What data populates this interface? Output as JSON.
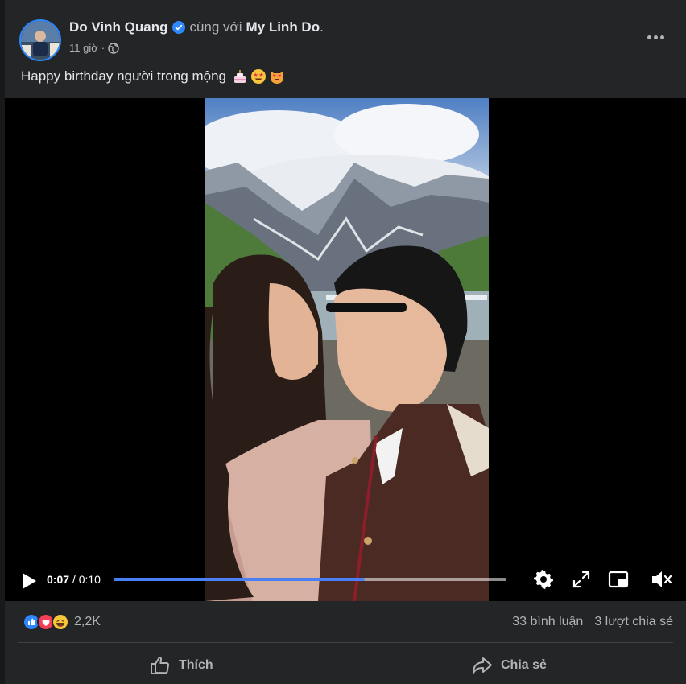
{
  "post": {
    "author": "Do Vinh Quang",
    "with_text": "cùng với",
    "tagged": "My Linh Do",
    "tag_end": ".",
    "time": "11 giờ",
    "separator": "·",
    "caption": "Happy birthday người trong mộng",
    "caption_emojis": [
      "cake-emoji",
      "star-struck-emoji",
      "heart-eyes-cat-emoji"
    ]
  },
  "video": {
    "current_time": "0:07",
    "time_sep": " / ",
    "duration": "0:10",
    "progress": 0.64
  },
  "footer": {
    "reactions": [
      "like-reaction",
      "love-reaction",
      "haha-reaction"
    ],
    "reaction_count": "2,2K",
    "comments": "33 bình luận",
    "shares": "3 lượt chia sẻ",
    "like_label": "Thích",
    "share_label": "Chia sẻ"
  },
  "colors": {
    "card_bg": "#242526",
    "page_bg": "#18191a",
    "text_primary": "#e4e6eb",
    "text_secondary": "#b0b3b8",
    "accent": "#2d88ff",
    "progress": "#4a80f5"
  }
}
